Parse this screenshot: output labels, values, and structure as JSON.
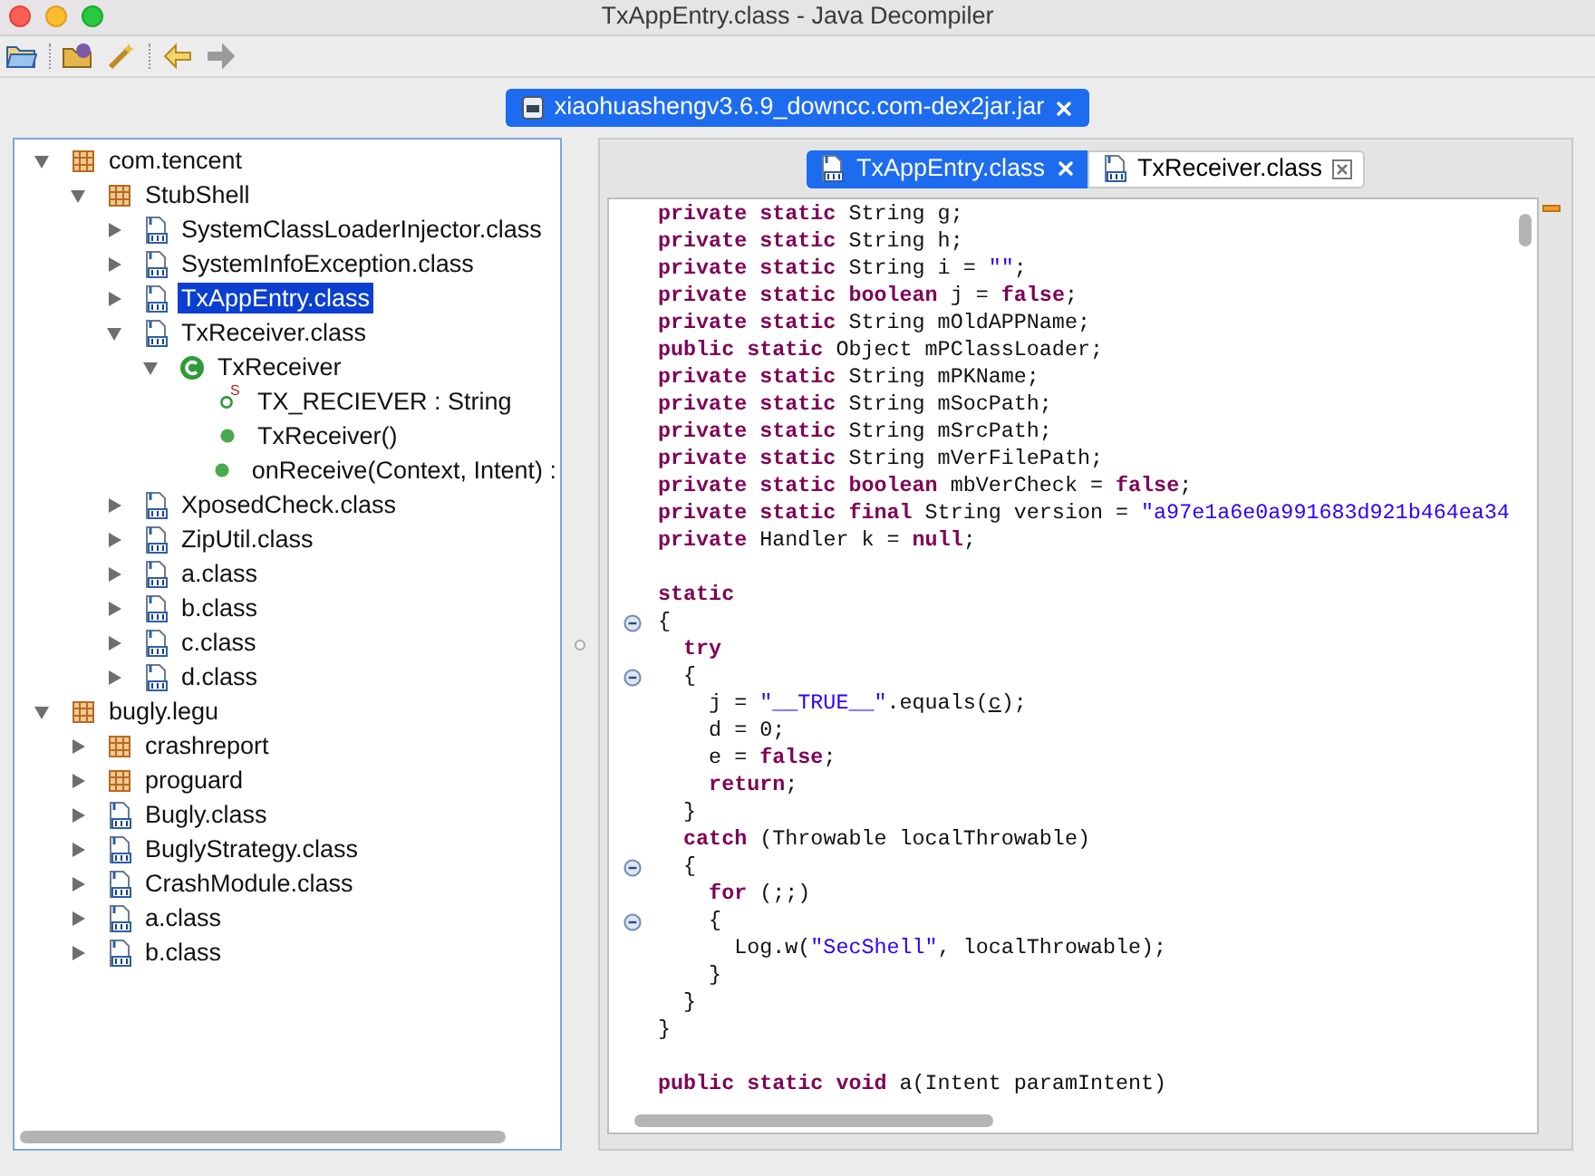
{
  "window": {
    "title": "TxAppEntry.class - Java Decompiler"
  },
  "toolbar": [
    {
      "kind": "open-file",
      "disabled": false
    },
    {
      "kind": "open-type",
      "disabled": false
    },
    {
      "kind": "wand",
      "disabled": false
    },
    {
      "kind": "back",
      "disabled": false
    },
    {
      "kind": "forward",
      "disabled": true
    }
  ],
  "file_tabs": [
    {
      "label": "xiaohuashengv3.6.9_downcc.com-dex2jar.jar",
      "selected": true
    }
  ],
  "tree": [
    {
      "label": "com.tencent",
      "kind": "package",
      "expanded": true,
      "selected": false,
      "children": [
        {
          "label": "StubShell",
          "kind": "package",
          "expanded": true,
          "selected": false,
          "children": [
            {
              "label": "SystemClassLoaderInjector.class",
              "kind": "classfile",
              "expanded": false,
              "selected": false
            },
            {
              "label": "SystemInfoException.class",
              "kind": "classfile",
              "expanded": false,
              "selected": false
            },
            {
              "label": "TxAppEntry.class",
              "kind": "classfile",
              "expanded": false,
              "selected": true
            },
            {
              "label": "TxReceiver.class",
              "kind": "classfile",
              "expanded": true,
              "selected": false,
              "children": [
                {
                  "label": "TxReceiver",
                  "kind": "class",
                  "expanded": true,
                  "selected": false,
                  "children": [
                    {
                      "label": "TX_RECIEVER : String",
                      "kind": "field",
                      "badge": "S",
                      "selected": false
                    },
                    {
                      "label": "TxReceiver()",
                      "kind": "method",
                      "selected": false
                    },
                    {
                      "label": "onReceive(Context, Intent) :",
                      "kind": "method",
                      "selected": false
                    }
                  ]
                }
              ]
            },
            {
              "label": "XposedCheck.class",
              "kind": "classfile",
              "expanded": false,
              "selected": false
            },
            {
              "label": "ZipUtil.class",
              "kind": "classfile",
              "expanded": false,
              "selected": false
            },
            {
              "label": "a.class",
              "kind": "classfile",
              "expanded": false,
              "selected": false
            },
            {
              "label": "b.class",
              "kind": "classfile",
              "expanded": false,
              "selected": false
            },
            {
              "label": "c.class",
              "kind": "classfile",
              "expanded": false,
              "selected": false
            },
            {
              "label": "d.class",
              "kind": "classfile",
              "expanded": false,
              "selected": false
            }
          ]
        }
      ]
    },
    {
      "label": "bugly.legu",
      "kind": "package",
      "expanded": true,
      "selected": false,
      "children": [
        {
          "label": "crashreport",
          "kind": "package",
          "expanded": false,
          "selected": false
        },
        {
          "label": "proguard",
          "kind": "package",
          "expanded": false,
          "selected": false
        },
        {
          "label": "Bugly.class",
          "kind": "classfile",
          "expanded": false,
          "selected": false
        },
        {
          "label": "BuglyStrategy.class",
          "kind": "classfile",
          "expanded": false,
          "selected": false
        },
        {
          "label": "CrashModule.class",
          "kind": "classfile",
          "expanded": false,
          "selected": false
        },
        {
          "label": "a.class",
          "kind": "classfile",
          "expanded": false,
          "selected": false
        },
        {
          "label": "b.class",
          "kind": "classfile",
          "expanded": false,
          "selected": false
        }
      ]
    }
  ],
  "editor_tabs": [
    {
      "label": "TxAppEntry.class",
      "selected": true
    },
    {
      "label": "TxReceiver.class",
      "selected": false
    }
  ],
  "code": [
    {
      "kind": "code",
      "fold": false,
      "tokens": [
        {
          "kind": "keyword",
          "text": "private static"
        },
        {
          "kind": "plain",
          "text": " String g;"
        }
      ]
    },
    {
      "kind": "code",
      "fold": false,
      "tokens": [
        {
          "kind": "keyword",
          "text": "private static"
        },
        {
          "kind": "plain",
          "text": " String h;"
        }
      ]
    },
    {
      "kind": "code",
      "fold": false,
      "tokens": [
        {
          "kind": "keyword",
          "text": "private static"
        },
        {
          "kind": "plain",
          "text": " String i = "
        },
        {
          "kind": "string",
          "text": "\"\""
        },
        {
          "kind": "plain",
          "text": ";"
        }
      ]
    },
    {
      "kind": "code",
      "fold": false,
      "tokens": [
        {
          "kind": "keyword",
          "text": "private static boolean"
        },
        {
          "kind": "plain",
          "text": " j = "
        },
        {
          "kind": "keyword",
          "text": "false"
        },
        {
          "kind": "plain",
          "text": ";"
        }
      ]
    },
    {
      "kind": "code",
      "fold": false,
      "tokens": [
        {
          "kind": "keyword",
          "text": "private static"
        },
        {
          "kind": "plain",
          "text": " String mOldAPPName;"
        }
      ]
    },
    {
      "kind": "code",
      "fold": false,
      "tokens": [
        {
          "kind": "keyword",
          "text": "public static"
        },
        {
          "kind": "plain",
          "text": " Object mPClassLoader;"
        }
      ]
    },
    {
      "kind": "code",
      "fold": false,
      "tokens": [
        {
          "kind": "keyword",
          "text": "private static"
        },
        {
          "kind": "plain",
          "text": " String mPKName;"
        }
      ]
    },
    {
      "kind": "code",
      "fold": false,
      "tokens": [
        {
          "kind": "keyword",
          "text": "private static"
        },
        {
          "kind": "plain",
          "text": " String mSocPath;"
        }
      ]
    },
    {
      "kind": "code",
      "fold": false,
      "tokens": [
        {
          "kind": "keyword",
          "text": "private static"
        },
        {
          "kind": "plain",
          "text": " String mSrcPath;"
        }
      ]
    },
    {
      "kind": "code",
      "fold": false,
      "tokens": [
        {
          "kind": "keyword",
          "text": "private static"
        },
        {
          "kind": "plain",
          "text": " String mVerFilePath;"
        }
      ]
    },
    {
      "kind": "code",
      "fold": false,
      "tokens": [
        {
          "kind": "keyword",
          "text": "private static boolean"
        },
        {
          "kind": "plain",
          "text": " mbVerCheck = "
        },
        {
          "kind": "keyword",
          "text": "false"
        },
        {
          "kind": "plain",
          "text": ";"
        }
      ]
    },
    {
      "kind": "code",
      "fold": false,
      "tokens": [
        {
          "kind": "keyword",
          "text": "private static final"
        },
        {
          "kind": "plain",
          "text": " String version = "
        },
        {
          "kind": "string",
          "text": "\"a97e1a6e0a991683d921b464ea34"
        }
      ]
    },
    {
      "kind": "code",
      "fold": false,
      "tokens": [
        {
          "kind": "keyword",
          "text": "private"
        },
        {
          "kind": "plain",
          "text": " Handler k = "
        },
        {
          "kind": "keyword",
          "text": "null"
        },
        {
          "kind": "plain",
          "text": ";"
        }
      ]
    },
    {
      "kind": "blank"
    },
    {
      "kind": "code",
      "fold": false,
      "tokens": [
        {
          "kind": "keyword",
          "text": "static"
        }
      ]
    },
    {
      "kind": "code",
      "fold": true,
      "tokens": [
        {
          "kind": "plain",
          "text": "{"
        }
      ]
    },
    {
      "kind": "code",
      "fold": false,
      "tokens": [
        {
          "kind": "keyword",
          "text": "  try"
        }
      ]
    },
    {
      "kind": "code",
      "fold": true,
      "tokens": [
        {
          "kind": "plain",
          "text": "  {"
        }
      ]
    },
    {
      "kind": "code",
      "fold": false,
      "tokens": [
        {
          "kind": "plain",
          "text": "    j = "
        },
        {
          "kind": "string",
          "text": "\"__TRUE__\""
        },
        {
          "kind": "plain",
          "text": ".equals("
        },
        {
          "kind": "reference",
          "text": "c"
        },
        {
          "kind": "plain",
          "text": ");"
        }
      ]
    },
    {
      "kind": "code",
      "fold": false,
      "tokens": [
        {
          "kind": "plain",
          "text": "    d = 0;"
        }
      ]
    },
    {
      "kind": "code",
      "fold": false,
      "tokens": [
        {
          "kind": "plain",
          "text": "    e = "
        },
        {
          "kind": "keyword",
          "text": "false"
        },
        {
          "kind": "plain",
          "text": ";"
        }
      ]
    },
    {
      "kind": "code",
      "fold": false,
      "tokens": [
        {
          "kind": "keyword",
          "text": "    return"
        },
        {
          "kind": "plain",
          "text": ";"
        }
      ]
    },
    {
      "kind": "code",
      "fold": false,
      "tokens": [
        {
          "kind": "plain",
          "text": "  }"
        }
      ]
    },
    {
      "kind": "code",
      "fold": false,
      "tokens": [
        {
          "kind": "keyword",
          "text": "  catch"
        },
        {
          "kind": "plain",
          "text": " (Throwable localThrowable)"
        }
      ]
    },
    {
      "kind": "code",
      "fold": true,
      "tokens": [
        {
          "kind": "plain",
          "text": "  {"
        }
      ]
    },
    {
      "kind": "code",
      "fold": false,
      "tokens": [
        {
          "kind": "keyword",
          "text": "    for"
        },
        {
          "kind": "plain",
          "text": " (;;)"
        }
      ]
    },
    {
      "kind": "code",
      "fold": true,
      "tokens": [
        {
          "kind": "plain",
          "text": "    {"
        }
      ]
    },
    {
      "kind": "code",
      "fold": false,
      "tokens": [
        {
          "kind": "plain",
          "text": "      Log.w("
        },
        {
          "kind": "string",
          "text": "\"SecShell\""
        },
        {
          "kind": "plain",
          "text": ", localThrowable);"
        }
      ]
    },
    {
      "kind": "code",
      "fold": false,
      "tokens": [
        {
          "kind": "plain",
          "text": "    }"
        }
      ]
    },
    {
      "kind": "code",
      "fold": false,
      "tokens": [
        {
          "kind": "plain",
          "text": "  }"
        }
      ]
    },
    {
      "kind": "code",
      "fold": false,
      "tokens": [
        {
          "kind": "plain",
          "text": "}"
        }
      ]
    },
    {
      "kind": "blank"
    },
    {
      "kind": "code",
      "fold": false,
      "tokens": [
        {
          "kind": "keyword",
          "text": "public static void"
        },
        {
          "kind": "plain",
          "text": " a(Intent paramIntent)"
        }
      ]
    }
  ]
}
